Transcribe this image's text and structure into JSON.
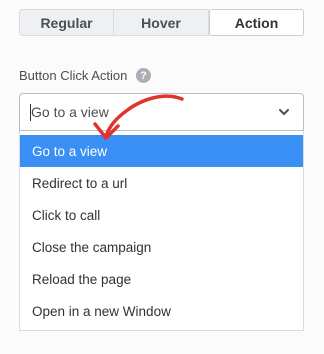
{
  "tabs": [
    {
      "label": "Regular"
    },
    {
      "label": "Hover"
    },
    {
      "label": "Action"
    }
  ],
  "field": {
    "label": "Button Click Action",
    "help_icon": "?"
  },
  "select": {
    "value": "Go to a view",
    "icon": "chevron-down-icon"
  },
  "options": [
    {
      "label": "Go to a view",
      "selected": true
    },
    {
      "label": "Redirect to a url",
      "selected": false
    },
    {
      "label": "Click to call",
      "selected": false
    },
    {
      "label": "Close the campaign",
      "selected": false
    },
    {
      "label": "Reload the page",
      "selected": false
    },
    {
      "label": "Open in a new Window",
      "selected": false
    }
  ],
  "colors": {
    "accent": "#3a8ff5",
    "annotation": "#e0342d"
  }
}
